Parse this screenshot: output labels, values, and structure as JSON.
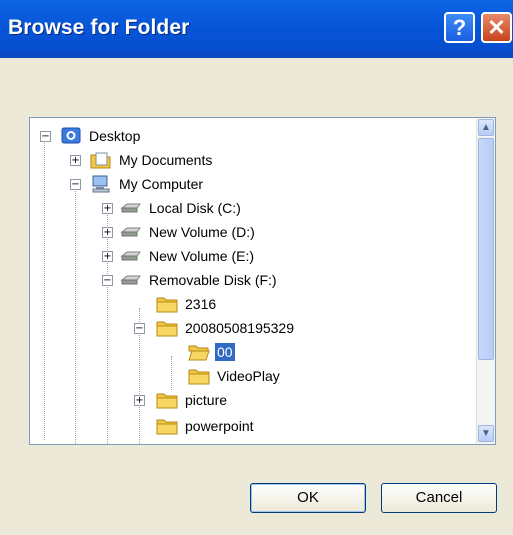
{
  "dialog": {
    "title": "Browse for Folder",
    "help_label": "?",
    "close_label": "✕"
  },
  "tree": [
    {
      "label": "Desktop",
      "icon": "desktop-icon",
      "expander": "−"
    },
    {
      "label": "My Documents",
      "icon": "documents-folder-icon",
      "expander": "+"
    },
    {
      "label": "My Computer",
      "icon": "computer-icon",
      "expander": "−"
    },
    {
      "label": "Local Disk (C:)",
      "icon": "drive-icon",
      "expander": "+"
    },
    {
      "label": "New Volume (D:)",
      "icon": "drive-icon",
      "expander": "+"
    },
    {
      "label": "New Volume (E:)",
      "icon": "drive-icon",
      "expander": "+"
    },
    {
      "label": "Removable Disk (F:)",
      "icon": "drive-icon",
      "expander": "−"
    },
    {
      "label": "2316",
      "icon": "folder-icon"
    },
    {
      "label": "20080508195329",
      "icon": "folder-icon",
      "expander": "−"
    },
    {
      "label": "00",
      "icon": "open-folder-icon",
      "selected": true
    },
    {
      "label": "VideoPlay",
      "icon": "folder-icon"
    },
    {
      "label": "picture",
      "icon": "folder-icon",
      "expander": "+"
    },
    {
      "label": "powerpoint",
      "icon": "folder-icon"
    }
  ],
  "buttons": {
    "ok": "OK",
    "cancel": "Cancel"
  },
  "colors": {
    "titlebar": "#0655d6",
    "selection": "#316ac5",
    "folder": "#f3c842"
  }
}
